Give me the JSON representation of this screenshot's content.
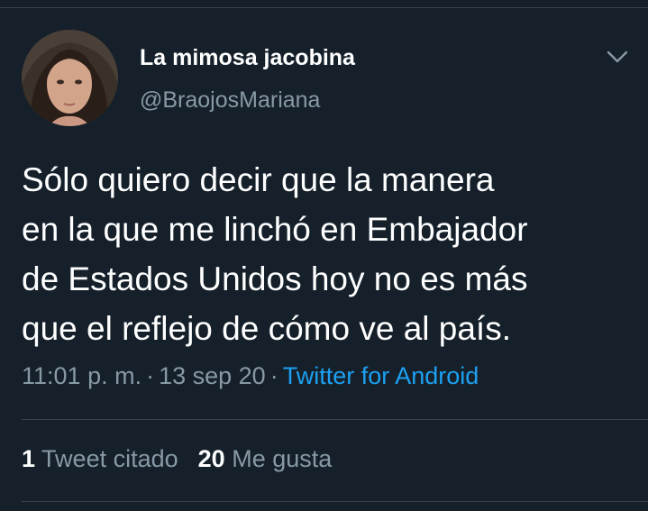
{
  "tweet": {
    "author": {
      "display_name": "La mimosa jacobina",
      "handle": "@BraojosMariana",
      "avatar": "profile-photo"
    },
    "text": "Sólo quiero decir que la manera\nen la que me linchó en Embajador\nde Estados Unidos hoy no es más\nque el reflejo de cómo ve al país.",
    "time": "11:01 p. m.",
    "separator": "·",
    "date": "13 sep 20",
    "source": "Twitter for Android",
    "stats": {
      "quote_count": "1",
      "quote_label": "Tweet citado",
      "like_count": "20",
      "like_label": "Me gusta"
    },
    "menu_icon": "chevron-down-icon"
  },
  "colors": {
    "background": "#15202b",
    "text": "#ffffff",
    "secondary": "#8899a6",
    "link": "#1da1f2",
    "divider": "#38444d"
  }
}
